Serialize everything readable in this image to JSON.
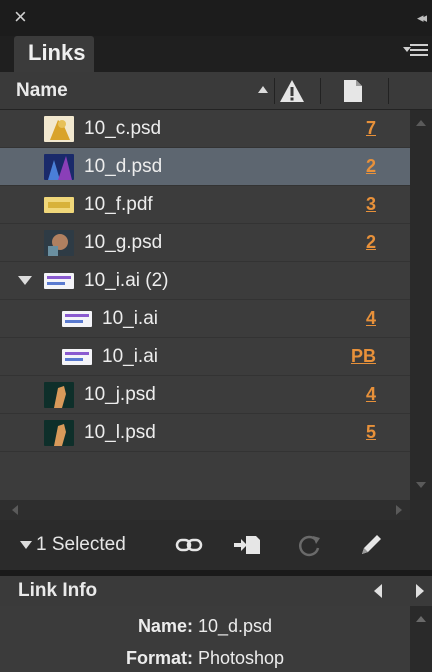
{
  "window": {
    "close_label": "×",
    "collapse_label": "◂◂"
  },
  "panel": {
    "tab_label": "Links"
  },
  "columns": {
    "name_label": "Name"
  },
  "links": [
    {
      "name": "10_c.psd",
      "count": "7",
      "thumb": "thumb-c"
    },
    {
      "name": "10_d.psd",
      "count": "2",
      "thumb": "thumb-d",
      "selected": true
    },
    {
      "name": "10_f.pdf",
      "count": "3",
      "thumb": "thumb-f"
    },
    {
      "name": "10_g.psd",
      "count": "2",
      "thumb": "thumb-g"
    },
    {
      "name": "10_i.ai (2)",
      "count": "",
      "thumb": "thumb-i",
      "expanded": true
    },
    {
      "name": "10_i.ai",
      "count": "4",
      "thumb": "thumb-i",
      "child": true
    },
    {
      "name": "10_i.ai",
      "count": "PB",
      "thumb": "thumb-i",
      "child": true
    },
    {
      "name": "10_j.psd",
      "count": "4",
      "thumb": "thumb-j"
    },
    {
      "name": "10_l.psd",
      "count": "5",
      "thumb": "thumb-j"
    }
  ],
  "toolbar": {
    "selected_text": "1 Selected"
  },
  "link_info": {
    "title": "Link Info",
    "name_label": "Name:",
    "name_value": "10_d.psd",
    "format_label": "Format:",
    "format_value": "Photoshop"
  },
  "colors": {
    "accent": "#e8913a",
    "selection": "#5d6670",
    "panel_bg": "#3c3c3c"
  },
  "icons": [
    "close-icon",
    "collapse-icon",
    "panel-menu-icon",
    "warning-icon",
    "page-icon",
    "relink-icon",
    "goto-link-icon",
    "update-link-icon",
    "edit-original-icon"
  ]
}
